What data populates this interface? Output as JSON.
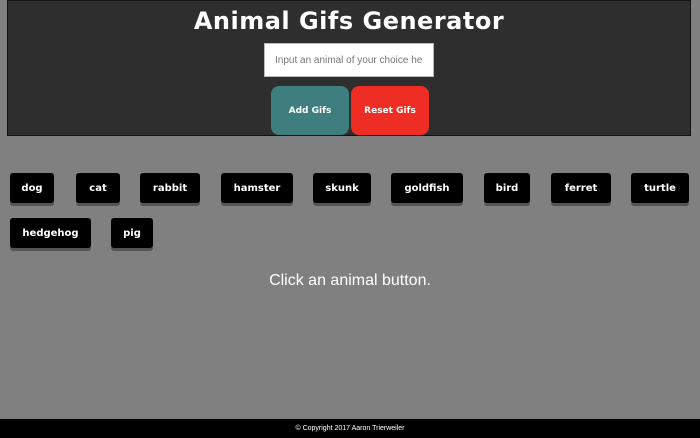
{
  "header": {
    "title": "Animal Gifs Generator",
    "search_placeholder": "Input an animal of your choice here",
    "add_label": "Add Gifs",
    "reset_label": "Reset Gifs"
  },
  "animals": [
    "dog",
    "cat",
    "rabbit",
    "hamster",
    "skunk",
    "goldfish",
    "bird",
    "ferret",
    "turtle",
    "hedgehog",
    "pig"
  ],
  "prompt": "Click an animal button.",
  "footer": {
    "copyright": "© Copyright 2017 Aaron Trierweiler"
  },
  "colors": {
    "page_bg": "#808080",
    "header_bg": "#2e2e2e",
    "add_button": "#3e7e7e",
    "reset_button": "#ee2e24",
    "animal_button": "#000000"
  }
}
